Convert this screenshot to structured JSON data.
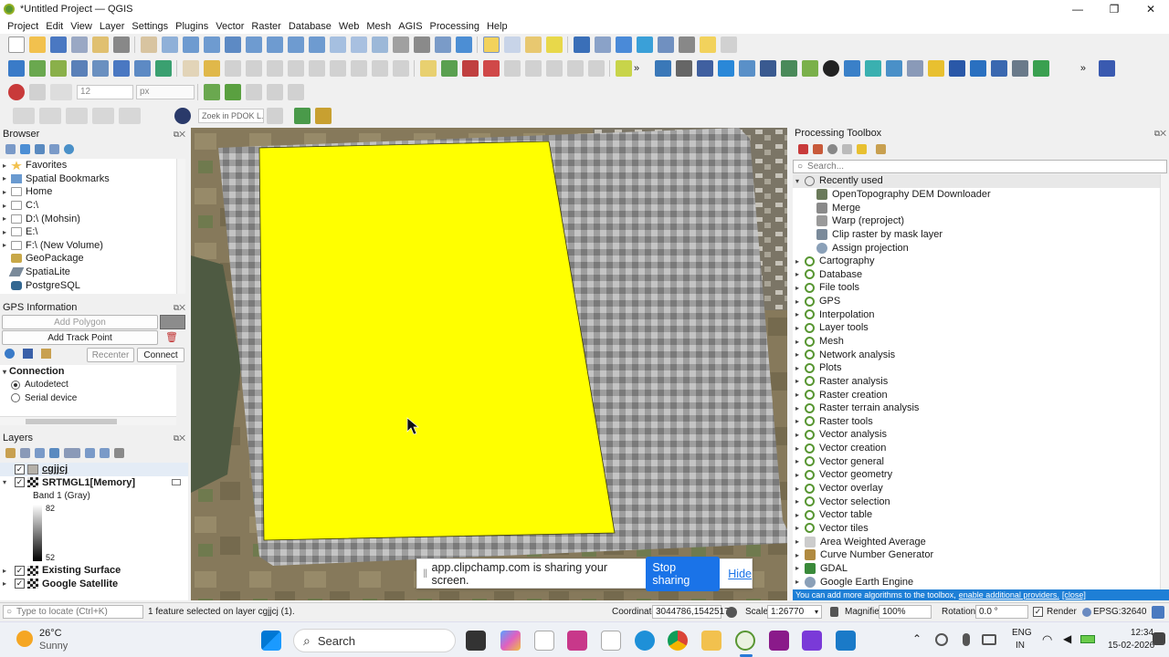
{
  "window": {
    "title": "*Untitled Project — QGIS",
    "min": "—",
    "max": "❐",
    "close": "✕"
  },
  "menu": [
    "Project",
    "Edit",
    "View",
    "Layer",
    "Settings",
    "Plugins",
    "Vector",
    "Raster",
    "Database",
    "Web",
    "Mesh",
    "AGIS",
    "Processing",
    "Help"
  ],
  "toolbar": {
    "stroke_width": "12",
    "unit": "px",
    "pdok_placeholder": "Zoek in PDOK L..."
  },
  "browser": {
    "title": "Browser",
    "items": [
      {
        "label": "Favorites",
        "icon": "star-icon"
      },
      {
        "label": "Spatial Bookmarks",
        "icon": "bookmark-icon"
      },
      {
        "label": "Home",
        "icon": "folder-icon"
      },
      {
        "label": "C:\\",
        "icon": "folder-icon"
      },
      {
        "label": "D:\\ (Mohsin)",
        "icon": "folder-icon"
      },
      {
        "label": "E:\\",
        "icon": "folder-icon"
      },
      {
        "label": "F:\\ (New Volume)",
        "icon": "folder-icon"
      },
      {
        "label": "GeoPackage",
        "icon": "geopackage-icon"
      },
      {
        "label": "SpatiaLite",
        "icon": "spatialite-icon"
      },
      {
        "label": "PostgreSQL",
        "icon": "postgresql-icon"
      }
    ]
  },
  "gps": {
    "title": "GPS Information",
    "add_polygon": "Add Polygon",
    "add_track_point": "Add Track Point",
    "recenter": "Recenter",
    "connect": "Connect",
    "connection_header": "Connection",
    "options": [
      "Autodetect",
      "Serial device"
    ]
  },
  "layers": {
    "title": "Layers",
    "items": [
      {
        "name": "cgjjcj",
        "checked": true
      },
      {
        "name": "SRTMGL1[Memory]",
        "checked": true
      },
      {
        "name": "Existing Surface",
        "checked": true
      },
      {
        "name": "Google Satellite",
        "checked": true
      }
    ],
    "band": "Band 1 (Gray)",
    "max": "82",
    "min": "52"
  },
  "processing": {
    "title": "Processing Toolbox",
    "search_placeholder": "Search...",
    "recent_header": "Recently used",
    "recent": [
      "OpenTopography DEM Downloader",
      "Merge",
      "Warp (reproject)",
      "Clip raster by mask layer",
      "Assign projection"
    ],
    "groups": [
      "Cartography",
      "Database",
      "File tools",
      "GPS",
      "Interpolation",
      "Layer tools",
      "Mesh",
      "Network analysis",
      "Plots",
      "Raster analysis",
      "Raster creation",
      "Raster terrain analysis",
      "Raster tools",
      "Vector analysis",
      "Vector creation",
      "Vector general",
      "Vector geometry",
      "Vector overlay",
      "Vector selection",
      "Vector table",
      "Vector tiles"
    ],
    "providers": [
      "Area Weighted Average",
      "Curve Number Generator",
      "GDAL",
      "Google Earth Engine"
    ],
    "footer_text": "You can add more algorithms to the toolbox,",
    "footer_link": "enable additional providers.",
    "footer_close": "[close]"
  },
  "share_banner": {
    "text": "app.clipchamp.com is sharing your screen.",
    "stop": "Stop sharing",
    "hide": "Hide"
  },
  "status": {
    "locate_placeholder": "Type to locate (Ctrl+K)",
    "message": "1 feature selected on layer cgjjcj (1).",
    "coordinate_label": "Coordinate",
    "coordinate": "3044786,1542517",
    "scale_label": "Scale",
    "scale": "1:26770",
    "magnifier_label": "Magnifier",
    "magnifier": "100%",
    "rotation_label": "Rotation",
    "rotation": "0.0 °",
    "render_label": "Render",
    "crs": "EPSG:32640"
  },
  "taskbar": {
    "temperature": "26°C",
    "weather": "Sunny",
    "search": "Search",
    "lang1": "ENG",
    "lang2": "IN",
    "time": "12:34",
    "date": "15-02-2026"
  },
  "colors": {
    "polygon": "#ffff00",
    "accent": "#1a73e8",
    "qgis_green": "#589632"
  }
}
